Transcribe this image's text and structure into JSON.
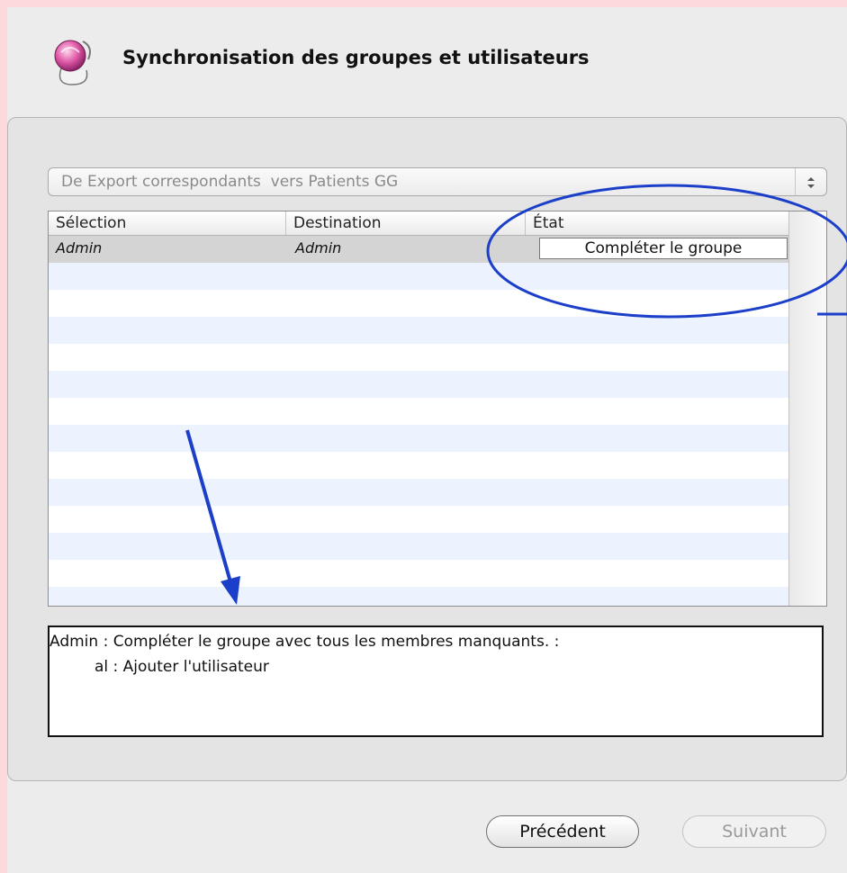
{
  "header": {
    "title": "Synchronisation des groupes et utilisateurs",
    "icon": "sync-app-icon"
  },
  "sync_popup": {
    "label": "De Export correspondants  vers Patients GG"
  },
  "table": {
    "columns": [
      "Sélection",
      "Destination",
      "État"
    ],
    "rows": [
      {
        "selection": "Admin",
        "destination": "Admin",
        "state": "Compléter le groupe"
      }
    ]
  },
  "message": {
    "line1": "Admin : Compléter le groupe avec tous les membres manquants. :",
    "line2": "al : Ajouter l'utilisateur"
  },
  "buttons": {
    "previous": "Précédent",
    "next": "Suivant"
  },
  "colors": {
    "page_background": "#fdd9dd",
    "annotation": "#1b3fc9",
    "row_alt": "#edf3fe"
  }
}
